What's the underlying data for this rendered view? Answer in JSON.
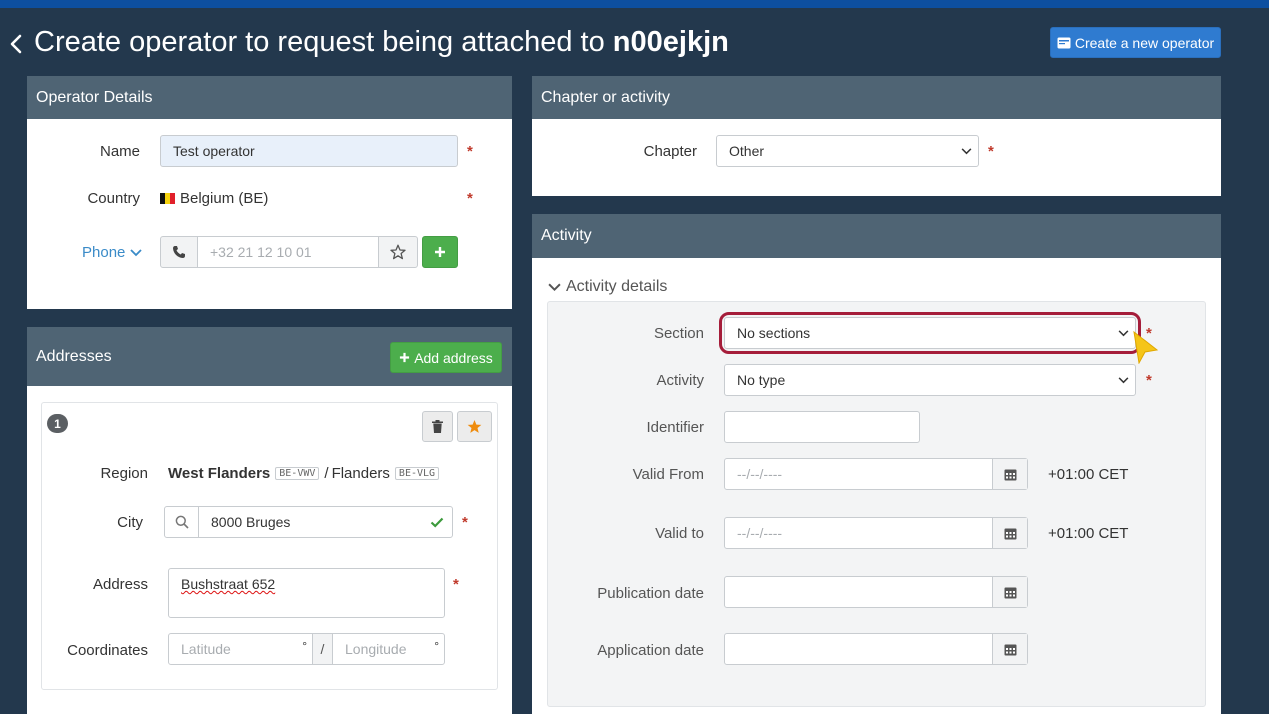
{
  "header": {
    "title_prefix": "Create operator to request being attached to",
    "title_entity": "n00ejkjn",
    "create_button_label": "Create a new operator"
  },
  "operator_details": {
    "heading": "Operator Details",
    "name_label": "Name",
    "name_value": "Test operator",
    "country_label": "Country",
    "country_value": "Belgium (BE)",
    "phone_label": "Phone",
    "phone_placeholder": "+32 21 12 10 01"
  },
  "addresses": {
    "heading": "Addresses",
    "add_button_label": "Add address",
    "item_number": "1",
    "region_label": "Region",
    "region_province": "West Flanders",
    "region_province_code": "BE-VWV",
    "region_separator": "/",
    "region_name": "Flanders",
    "region_code": "BE-VLG",
    "city_label": "City",
    "city_value": "8000 Bruges",
    "address_label": "Address",
    "address_value": "Bushstraat 652",
    "coordinates_label": "Coordinates",
    "latitude_placeholder": "Latitude",
    "longitude_placeholder": "Longitude",
    "degree_symbol": "°",
    "coord_separator": "/"
  },
  "chapter": {
    "heading": "Chapter or activity",
    "chapter_label": "Chapter",
    "chapter_value": "Other"
  },
  "activity": {
    "heading": "Activity",
    "details_toggle": "Activity details",
    "section_label": "Section",
    "section_value": "No sections",
    "activity_label": "Activity",
    "activity_value": "No type",
    "identifier_label": "Identifier",
    "valid_from_label": "Valid From",
    "valid_to_label": "Valid to",
    "date_placeholder": "--/--/----",
    "timezone": "+01:00 CET",
    "publication_label": "Publication date",
    "application_label": "Application date"
  },
  "required_mark": "*",
  "colors": {
    "background": "#23384d",
    "panel_header": "#4f6474",
    "primary_button": "#2f7bd0",
    "success_button": "#4cae4c",
    "highlight_outline": "#a51d3a",
    "cursor": "#f5c518"
  }
}
